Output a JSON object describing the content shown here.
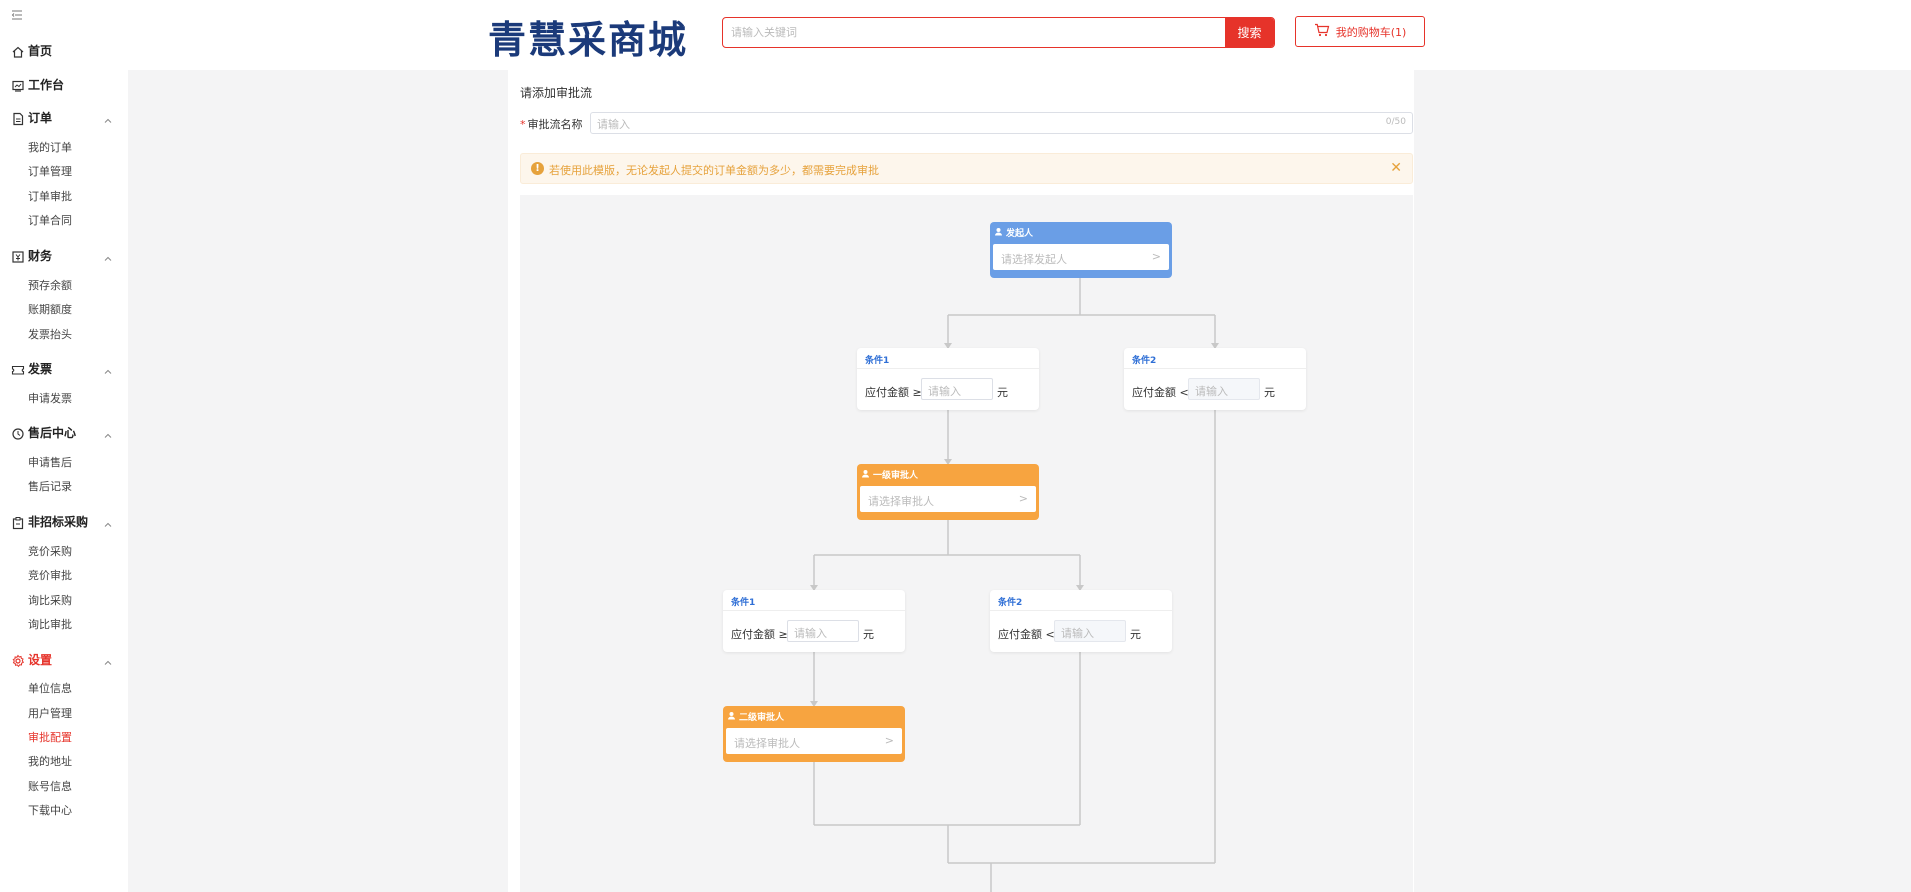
{
  "sidebar": {
    "groups": [
      {
        "label": "首页",
        "icon": "home-icon",
        "collapsible": false,
        "items": []
      },
      {
        "label": "工作台",
        "icon": "workbench-icon",
        "collapsible": false,
        "items": []
      },
      {
        "label": "订单",
        "icon": "order-icon",
        "collapsible": true,
        "items": [
          "我的订单",
          "订单管理",
          "订单审批",
          "订单合同"
        ]
      },
      {
        "label": "财务",
        "icon": "finance-icon",
        "collapsible": true,
        "items": [
          "预存余额",
          "账期额度",
          "发票抬头"
        ]
      },
      {
        "label": "发票",
        "icon": "invoice-icon",
        "collapsible": true,
        "items": [
          "申请发票"
        ]
      },
      {
        "label": "售后中心",
        "icon": "after-sales-icon",
        "collapsible": true,
        "items": [
          "申请售后",
          "售后记录"
        ]
      },
      {
        "label": "非招标采购",
        "icon": "procurement-icon",
        "collapsible": true,
        "items": [
          "竞价采购",
          "竞价审批",
          "询比采购",
          "询比审批"
        ]
      },
      {
        "label": "设置",
        "icon": "settings-icon",
        "collapsible": true,
        "active": true,
        "items": [
          "单位信息",
          "用户管理",
          "审批配置",
          "我的地址",
          "账号信息",
          "下载中心"
        ]
      }
    ],
    "active_item": "审批配置"
  },
  "header": {
    "logo": "青慧采商城",
    "search_placeholder": "请输入关键词",
    "search_button": "搜索",
    "cart_label": "我的购物车(1)"
  },
  "form": {
    "title": "请添加审批流",
    "name_label": "审批流名称",
    "name_placeholder": "请输入",
    "name_count": "0/50",
    "alert_text": "若使用此模版，无论发起人提交的订单金额为多少，都需要完成审批"
  },
  "flow": {
    "start": {
      "title": "发起人",
      "placeholder": "请选择发起人"
    },
    "cond_a1": {
      "title": "条件1",
      "label": "应付金额 ≥",
      "placeholder": "请输入",
      "unit": "元"
    },
    "cond_a2": {
      "title": "条件2",
      "label": "应付金额 <",
      "placeholder": "请输入",
      "unit": "元"
    },
    "approver1": {
      "title": "一级审批人",
      "placeholder": "请选择审批人"
    },
    "cond_b1": {
      "title": "条件1",
      "label": "应付金额 ≥",
      "placeholder": "请输入",
      "unit": "元"
    },
    "cond_b2": {
      "title": "条件2",
      "label": "应付金额 <",
      "placeholder": "请输入",
      "unit": "元"
    },
    "approver2": {
      "title": "二级审批人",
      "placeholder": "请选择审批人"
    }
  },
  "colors": {
    "brand_red": "#e6332a",
    "logo_blue": "#1b3a7a",
    "start_node": "#6a9ee6",
    "approver_node": "#f7a440",
    "condition_title": "#2f6fd6",
    "alert_orange": "#e6a23c"
  }
}
